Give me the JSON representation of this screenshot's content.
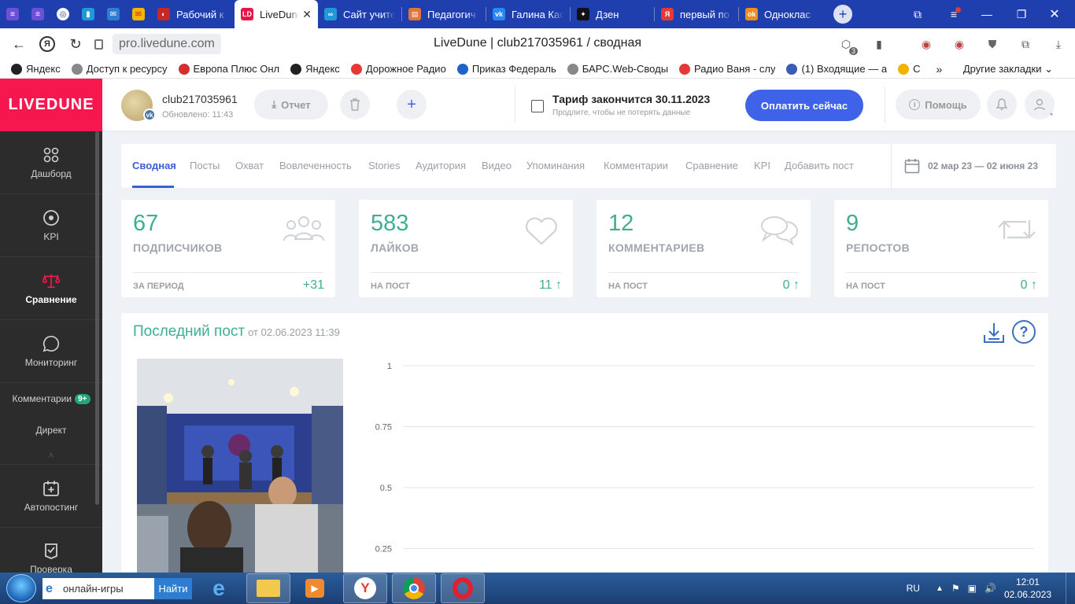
{
  "browser": {
    "tabs": [
      {
        "label": "Рабочий к",
        "color": "#c62828",
        "glyph": "◐"
      },
      {
        "label": "LiveDune",
        "color": "#e5174a",
        "glyph": "LD",
        "active": true
      },
      {
        "label": "Сайт учите",
        "color": "#1f9ad6",
        "glyph": "∞"
      },
      {
        "label": "Педагогич",
        "color": "#e0763a",
        "glyph": "▤"
      },
      {
        "label": "Галина Кас",
        "color": "#2787f5",
        "glyph": "vk"
      },
      {
        "label": "Дзен",
        "color": "#111111",
        "glyph": "✦"
      },
      {
        "label": "первый по",
        "color": "#e53935",
        "glyph": "Я"
      },
      {
        "label": "Одноклас",
        "color": "#f28c18",
        "glyph": "ok"
      }
    ],
    "close_glyph": "✕",
    "new_tab_glyph": "+",
    "url": "pro.livedune.com",
    "page_title": "LiveDune | club217035961 / сводная",
    "extension_count": "3",
    "bookmarks": [
      {
        "label": "Яндекс",
        "color": "#222"
      },
      {
        "label": "Доступ к ресурсу",
        "color": "#888"
      },
      {
        "label": "Европа Плюс Онл",
        "color": "#d32f2f"
      },
      {
        "label": "Яндекс",
        "color": "#222"
      },
      {
        "label": "Дорожное Радио",
        "color": "#e53935"
      },
      {
        "label": "Приказ Федераль",
        "color": "#1e63c8"
      },
      {
        "label": "БАРС.Web-Своды",
        "color": "#888"
      },
      {
        "label": "Радио Ваня - слу",
        "color": "#e53935"
      },
      {
        "label": "(1) Входящие — а",
        "color": "#3b5bb8"
      },
      {
        "label": "С",
        "color": "#f0b400"
      }
    ],
    "bookmarks_more": "»",
    "bookmarks_other": "Другие закладки"
  },
  "sidebar": {
    "logo": "LIVEDUNE",
    "items": [
      {
        "label": "Дашборд",
        "icon": "dashboard-icon"
      },
      {
        "label": "KPI",
        "icon": "target-icon"
      },
      {
        "label": "Сравнение",
        "icon": "scales-icon",
        "active": true
      },
      {
        "label": "Мониторинг",
        "icon": "chat-bubble-icon"
      }
    ],
    "comments_label": "Комментарии",
    "comments_badge": "9+",
    "direct_label": "Директ",
    "collapse_glyph": "˄",
    "autopost_label": "Автопостинг",
    "check_label": "Проверка"
  },
  "header": {
    "account_name": "club217035961",
    "updated": "Обновлено: 11:43",
    "report_label": "Отчет",
    "tariff_title": "Тариф закончится 30.11.2023",
    "tariff_sub": "Продлите, чтобы не потерять данные",
    "pay_label": "Оплатить сейчас",
    "help_label": "Помощь"
  },
  "nav": {
    "tabs": [
      "Сводная",
      "Посты",
      "Охват",
      "Вовлеченность",
      "Stories",
      "Аудитория",
      "Видео",
      "Упоминания",
      "Комментарии",
      "Сравнение",
      "KPI",
      "Добавить пост"
    ],
    "date_range": "02 мар 23 — 02 июня 23"
  },
  "stats": [
    {
      "value": "67",
      "label": "ПОДПИСЧИКОВ",
      "period": "ЗА ПЕРИОД",
      "delta": "+31",
      "icon": "users-icon"
    },
    {
      "value": "583",
      "label": "ЛАЙКОВ",
      "period": "НА ПОСТ",
      "delta": "11 ↑",
      "icon": "heart-icon"
    },
    {
      "value": "12",
      "label": "КОММЕНТАРИЕВ",
      "period": "НА ПОСТ",
      "delta": "0 ↑",
      "icon": "comments-icon"
    },
    {
      "value": "9",
      "label": "РЕПОСТОВ",
      "period": "НА ПОСТ",
      "delta": "0 ↑",
      "icon": "repost-icon"
    }
  ],
  "last_post": {
    "title": "Последний пост",
    "date": "от 02.06.2023 11:39"
  },
  "chart_data": {
    "type": "line",
    "title": "",
    "xlabel": "",
    "ylabel": "",
    "ylim": [
      0,
      1
    ],
    "y_ticks": [
      "1",
      "0.75",
      "0.5",
      "0.25"
    ],
    "series": [],
    "grid": true
  },
  "taskbar": {
    "search_value": "онлайн-игры",
    "search_button": "Найти",
    "lang": "RU",
    "time": "12:01",
    "date": "02.06.2023"
  }
}
